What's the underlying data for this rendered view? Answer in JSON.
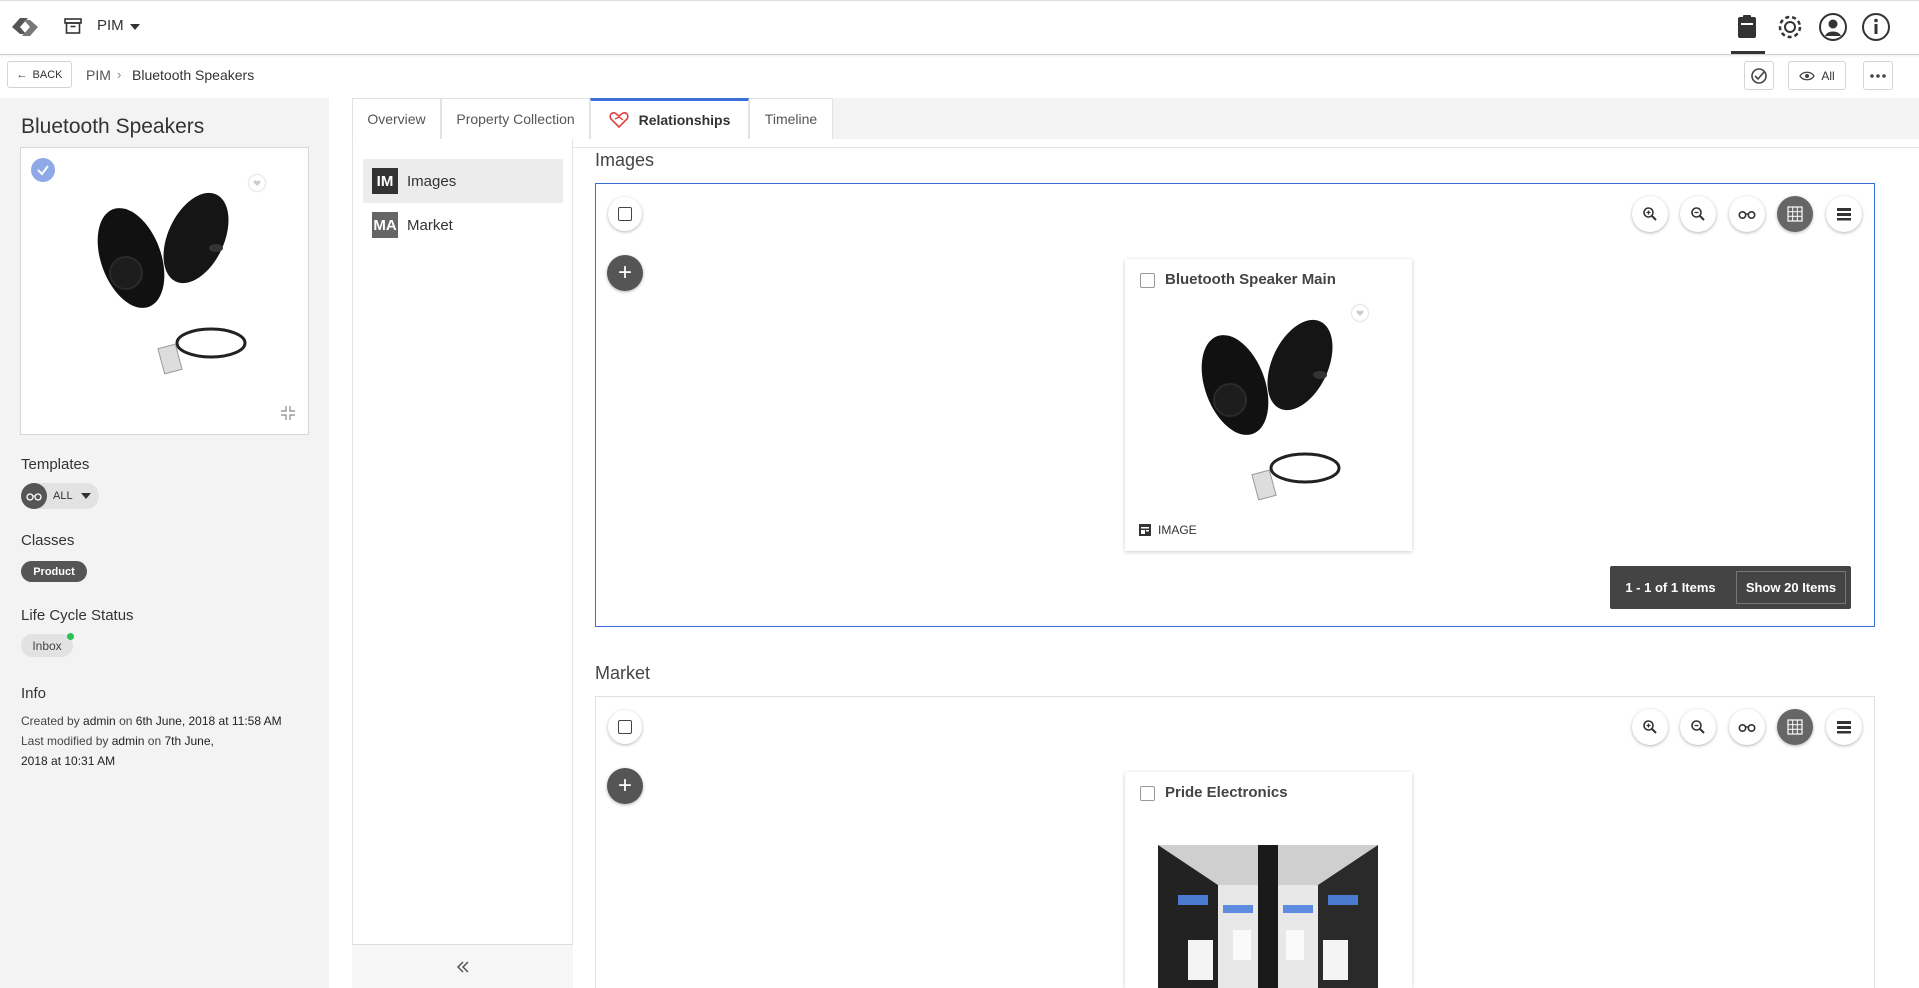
{
  "topbar": {
    "module_label": "PIM",
    "icons": [
      "logo-icon",
      "archive-icon",
      "clipboard-icon",
      "gear-icon",
      "user-icon",
      "info-icon"
    ]
  },
  "breadcrumb": {
    "back_label": "BACK",
    "items": [
      "PIM",
      "Bluetooth Speakers"
    ]
  },
  "actions": {
    "view_label": "All"
  },
  "entity": {
    "title": "Bluetooth Speakers",
    "templates_label": "Templates",
    "template_value": "ALL",
    "classes_label": "Classes",
    "class_value": "Product",
    "lifecycle_label": "Life Cycle Status",
    "lifecycle_value": "Inbox",
    "info_label": "Info",
    "created_prefix": "Created by",
    "created_by": "admin",
    "created_on": "on",
    "created_date": "6th June, 2018 at 11:58 AM",
    "modified_prefix": "Last modified by",
    "modified_by": "admin",
    "modified_on": "on",
    "modified_date_1": "7th June,",
    "modified_date_2": "2018 at 10:31 AM"
  },
  "tabs": [
    {
      "label": "Overview"
    },
    {
      "label": "Property Collection"
    },
    {
      "label": "Relationships"
    },
    {
      "label": "Timeline"
    }
  ],
  "nav": {
    "items": [
      {
        "badge": "IM",
        "label": "Images",
        "color": "#333333"
      },
      {
        "badge": "MA",
        "label": "Market",
        "color": "#666666"
      }
    ]
  },
  "sections": {
    "images": {
      "title": "Images",
      "card_title": "Bluetooth Speaker Main",
      "card_type": "IMAGE",
      "pager_range": "1 - 1 of 1 Items",
      "pager_size": "Show 20 Items"
    },
    "market": {
      "title": "Market",
      "card_title": "Pride Electronics"
    }
  },
  "colors": {
    "accent": "#3b6fd8",
    "status_green": "#2bbf5a",
    "dark_chip": "#555555"
  }
}
